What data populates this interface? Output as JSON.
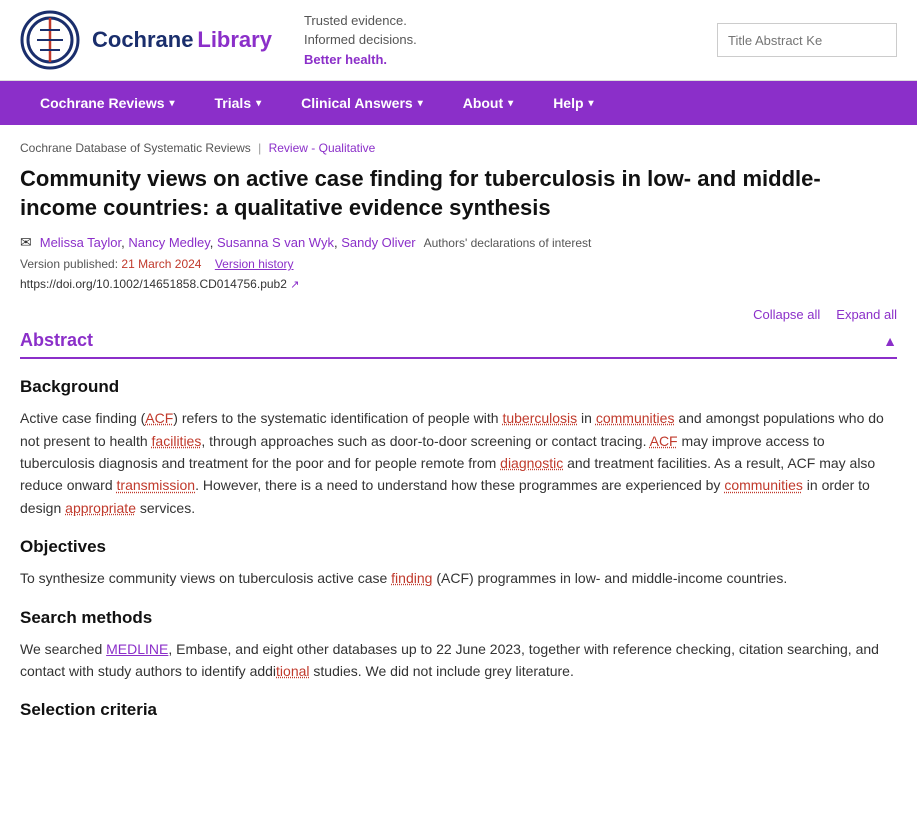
{
  "header": {
    "logo_cochrane": "Cochrane",
    "logo_library": "Library",
    "tagline_line1": "Trusted evidence.",
    "tagline_line2": "Informed decisions.",
    "tagline_line3": "Better health.",
    "search_placeholder": "Title Abstract Ke"
  },
  "nav": {
    "items": [
      {
        "label": "Cochrane Reviews",
        "id": "cochrane-reviews"
      },
      {
        "label": "Trials",
        "id": "trials"
      },
      {
        "label": "Clinical Answers",
        "id": "clinical-answers"
      },
      {
        "label": "About",
        "id": "about"
      },
      {
        "label": "Help",
        "id": "help"
      }
    ]
  },
  "breadcrumb": {
    "parent": "Cochrane Database of Systematic Reviews",
    "current": "Review - Qualitative"
  },
  "article": {
    "title": "Community views on active case finding for tuberculosis in low- and middle-income countries: a qualitative evidence synthesis",
    "authors": "Melissa Taylor, Nancy Medley, Susanna S van Wyk, Sandy Oliver",
    "declarations_label": "Authors' declarations of interest",
    "version_published_label": "Version published:",
    "version_date": "21 March 2024",
    "version_history_label": "Version history",
    "doi": "https://doi.org/10.1002/14651858.CD014756.pub2"
  },
  "controls": {
    "collapse_all": "Collapse all",
    "expand_all": "Expand all"
  },
  "abstract": {
    "title": "Abstract",
    "sections": [
      {
        "heading": "Background",
        "body": "Active case finding (ACF) refers to the systematic identification of people with tuberculosis in communities and amongst populations who do not present to health facilities, through approaches such as door-to-door screening or contact tracing. ACF may improve access to tuberculosis diagnosis and treatment for the poor and for people remote from diagnostic and treatment facilities. As a result, ACF may also reduce onward transmission. However, there is a need to understand how these programmes are experienced by communities in order to design appropriate services."
      },
      {
        "heading": "Objectives",
        "body": "To synthesize community views on tuberculosis active case finding (ACF) programmes in low- and middle-income countries."
      },
      {
        "heading": "Search methods",
        "body": "We searched MEDLINE, Embase, and eight other databases up to 22 June 2023, together with reference checking, citation searching, and contact with study authors to identify additional studies. We did not include grey literature."
      },
      {
        "heading": "Selection criteria",
        "body": ""
      }
    ]
  }
}
